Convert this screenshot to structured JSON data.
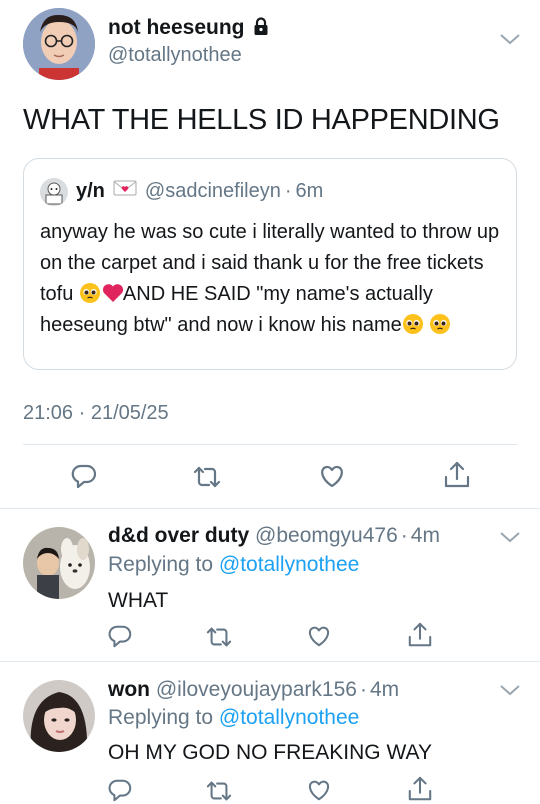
{
  "main_tweet": {
    "display_name": "not heeseung",
    "handle": "@totallynothee",
    "text": "WHAT THE HELLS ID HAPPENDING",
    "timestamp": "21:06 · 21/05/25",
    "icons": {
      "lock": "lock-icon",
      "chevron": "chevron-down-icon"
    },
    "quoted": {
      "display_name": "y/n",
      "handle": "@sadcinefileyn",
      "time": "6m",
      "text_part1": "anyway he was so cute i literally wanted to throw up on the carpet and i said thank u for the free tickets tofu ",
      "text_part2": "AND HE SAID \"my name's actually heeseung btw\" and now i know his name",
      "icons": {
        "name_emoji": "love-letter-icon",
        "inline_emojis": [
          "pleading-face-icon",
          "red-heart-icon",
          "pleading-face-icon",
          "pleading-face-icon"
        ]
      }
    },
    "actions": [
      "reply-icon",
      "retweet-icon",
      "like-icon",
      "share-icon"
    ]
  },
  "replies": [
    {
      "display_name": "d&d over duty",
      "handle": "@beomgyu476",
      "time": "4m",
      "replying_prefix": "Replying to ",
      "replying_to": "@totallynothee",
      "text": "WHAT"
    },
    {
      "display_name": "won",
      "handle": "@iloveyoujaypark156",
      "time": "4m",
      "replying_prefix": "Replying to ",
      "replying_to": "@totallynothee",
      "text": "OH MY GOD NO FREAKING WAY"
    }
  ],
  "colors": {
    "link": "#1da1f2",
    "muted": "#657786",
    "divider": "#e1e8ed",
    "heart": "#e0245e"
  }
}
